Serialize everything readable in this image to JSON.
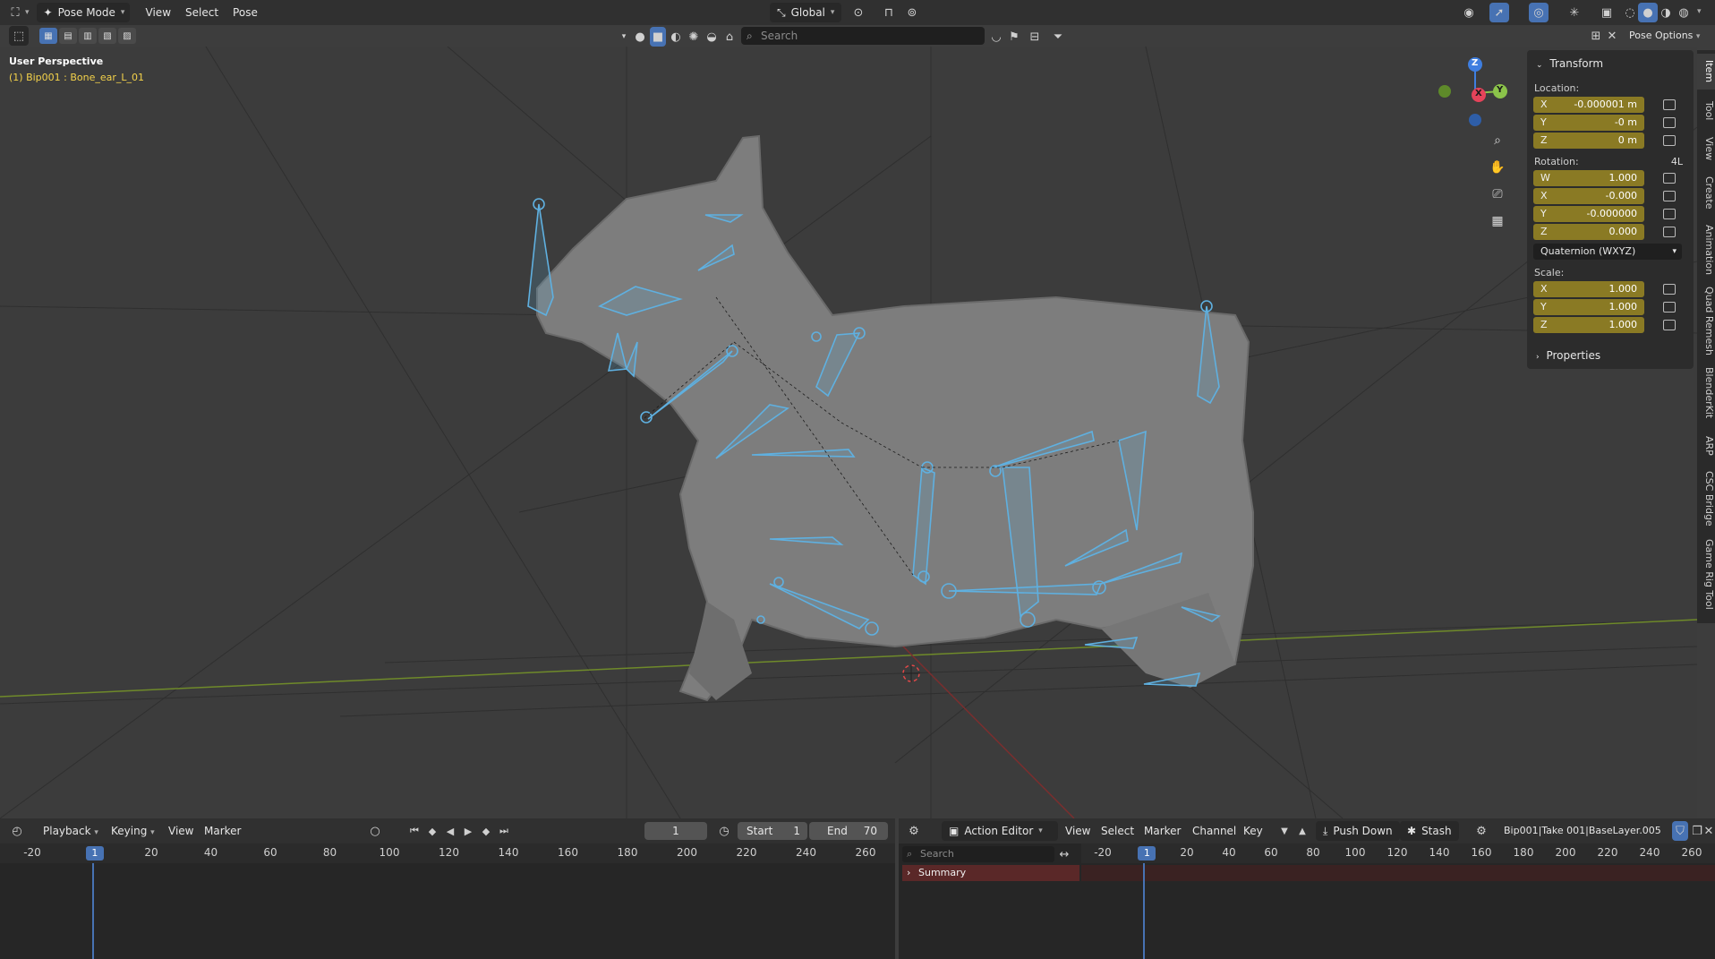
{
  "header": {
    "mode": "Pose Mode",
    "menus": [
      "View",
      "Select",
      "Pose"
    ],
    "transform_orientation": "Global",
    "pose_options": "Pose Options"
  },
  "viewport": {
    "search_placeholder": "Search",
    "perspective": "User Perspective",
    "active_bone": "(1) Bip001 : Bone_ear_L_01",
    "gizmo": {
      "z": "Z",
      "x": "X",
      "y": "Y"
    }
  },
  "npanel": {
    "title": "Transform",
    "location_label": "Location:",
    "location": [
      {
        "axis": "X",
        "value": "-0.000001 m"
      },
      {
        "axis": "Y",
        "value": "-0 m"
      },
      {
        "axis": "Z",
        "value": "0 m"
      }
    ],
    "rotation_label": "Rotation:",
    "rotation_mode_badge": "4L",
    "rotation": [
      {
        "axis": "W",
        "value": "1.000"
      },
      {
        "axis": "X",
        "value": "-0.000"
      },
      {
        "axis": "Y",
        "value": "-0.000000"
      },
      {
        "axis": "Z",
        "value": "0.000"
      }
    ],
    "rotation_mode": "Quaternion (WXYZ)",
    "scale_label": "Scale:",
    "scale": [
      {
        "axis": "X",
        "value": "1.000"
      },
      {
        "axis": "Y",
        "value": "1.000"
      },
      {
        "axis": "Z",
        "value": "1.000"
      }
    ],
    "properties_label": "Properties"
  },
  "sidebar_tabs": [
    "Item",
    "Tool",
    "View",
    "Create",
    "Animation",
    "Quad Remesh",
    "BlenderKit",
    "ARP",
    "CSC Bridge",
    "Game Rig Tool"
  ],
  "timeline": {
    "menus": [
      "Playback",
      "Keying",
      "View",
      "Marker"
    ],
    "current_frame": "1",
    "start_label": "Start",
    "start": "1",
    "end_label": "End",
    "end": "70",
    "ruler": [
      "-20",
      "1",
      "20",
      "40",
      "60",
      "80",
      "100",
      "120",
      "140",
      "160",
      "180",
      "200",
      "220",
      "240",
      "260"
    ]
  },
  "action_editor": {
    "mode": "Action Editor",
    "menus": [
      "View",
      "Select",
      "Marker",
      "Channel",
      "Key"
    ],
    "push_down": "Push Down",
    "stash": "Stash",
    "action_name": "Bip001|Take 001|BaseLayer.005",
    "search_placeholder": "Search",
    "summary": "Summary",
    "ruler": [
      "-20",
      "1",
      "20",
      "40",
      "60",
      "80",
      "100",
      "120",
      "140",
      "160",
      "180",
      "200",
      "220",
      "240",
      "260"
    ]
  },
  "colors": {
    "accent": "#4772b3",
    "bone": "#5fb0e0",
    "field_yellow": "#8a7a24",
    "axis_x": "#e5435a",
    "axis_y": "#8bc34a",
    "axis_z": "#3e7ee0"
  }
}
